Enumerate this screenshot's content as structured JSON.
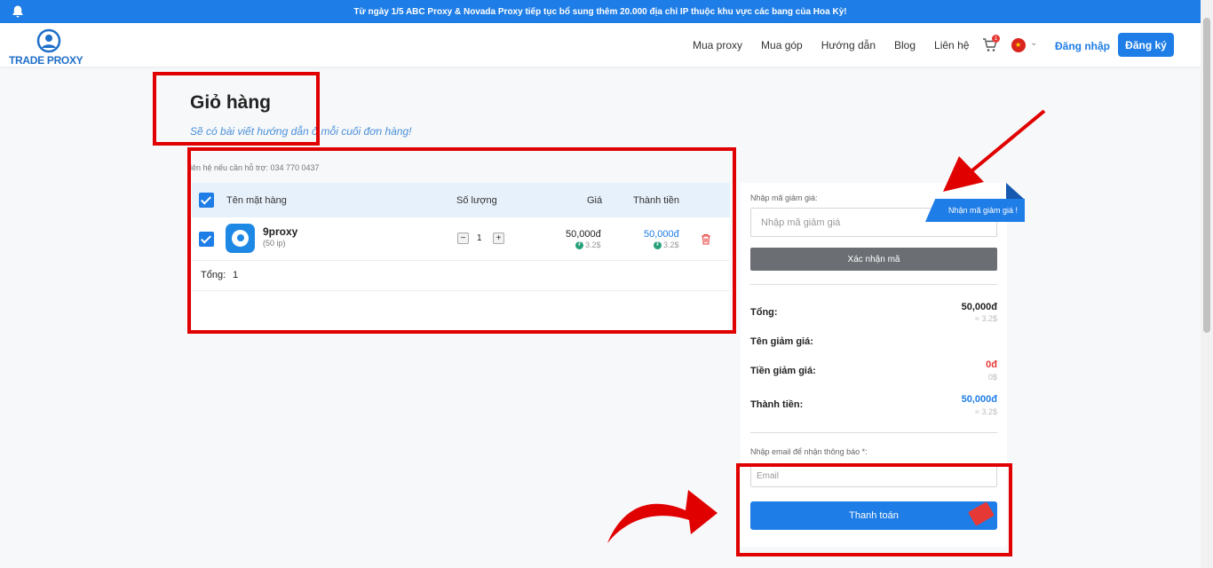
{
  "announcement": "Từ ngày 1/5 ABC Proxy & Novada Proxy tiếp tục bổ sung thêm 20.000 địa chỉ IP thuộc khu vực các bang của Hoa Kỳ!",
  "brand": {
    "logo_text": "TRADE PROXY"
  },
  "nav": {
    "links": [
      "Mua proxy",
      "Mua góp",
      "Hướng dẫn",
      "Blog",
      "Liên hệ"
    ],
    "cart_count": "1",
    "login": "Đăng nhập",
    "signup": "Đăng ký"
  },
  "page": {
    "title": "Giỏ hàng",
    "subtitle": "Sẽ có bài viết hướng dẫn ở mỗi cuối đơn hàng!",
    "support": "iên hệ nếu cần hỗ trợ: 034 770 0437"
  },
  "cart": {
    "headers": {
      "name": "Tên mặt hàng",
      "qty": "Số lượng",
      "price": "Giá",
      "subtotal": "Thành tiền"
    },
    "items": [
      {
        "name": "9proxy",
        "sub": "(50 ip)",
        "qty": "1",
        "price": "50,000đ",
        "price_usd": "3.2$",
        "subtotal": "50,000đ",
        "subtotal_usd": "3.2$"
      }
    ],
    "total_label": "Tổng:",
    "total_value": "1"
  },
  "summary": {
    "coupon_label": "Nhập mã giảm giá:",
    "coupon_placeholder": "Nhập mã giảm giá",
    "coupon_ribbon": "Nhận mã giảm giá !",
    "confirm_button": "Xác nhận mã",
    "total_label": "Tổng:",
    "total_value": "50,000đ",
    "total_usd": "≈ 3.2$",
    "discount_name_label": "Tên giảm giá:",
    "discount_amount_label": "Tiền giảm giá:",
    "discount_value": "0đ",
    "discount_usd": "0$",
    "final_label": "Thành tiền:",
    "final_value": "50,000đ",
    "final_usd": "≈ 3.2$",
    "email_label": "Nhập email để nhận thông báo *:",
    "email_placeholder": "Email",
    "pay_button": "Thanh toán"
  },
  "colors": {
    "accent": "#1e7de6",
    "highlight": "#e00000",
    "discount": "#e53935"
  }
}
